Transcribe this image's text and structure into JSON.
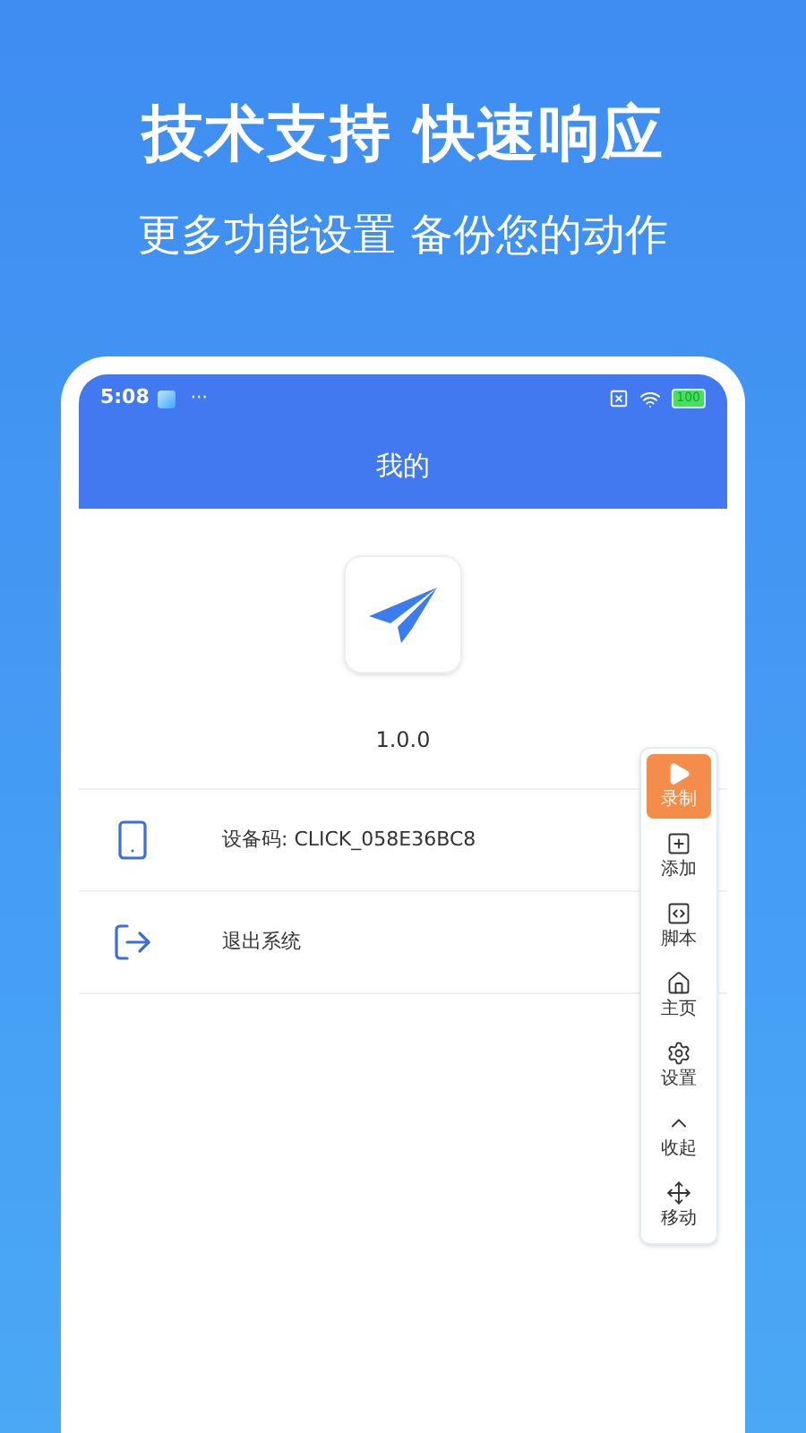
{
  "headline": "技术支持 快速响应",
  "subheadline": "更多功能设置 备份您的动作",
  "status_bar": {
    "time": "5:08",
    "dots": "···",
    "battery": "100"
  },
  "header": {
    "title": "我的"
  },
  "app": {
    "version": "1.0.0"
  },
  "menu": [
    {
      "kind": "device",
      "label": "设备码: CLICK_058E36BC8"
    },
    {
      "kind": "logout",
      "label": "退出系统"
    }
  ],
  "toolbar": [
    {
      "kind": "record",
      "label": "录制"
    },
    {
      "kind": "add",
      "label": "添加"
    },
    {
      "kind": "script",
      "label": "脚本"
    },
    {
      "kind": "home",
      "label": "主页"
    },
    {
      "kind": "settings",
      "label": "设置"
    },
    {
      "kind": "collapse",
      "label": "收起"
    },
    {
      "kind": "move",
      "label": "移动"
    }
  ]
}
